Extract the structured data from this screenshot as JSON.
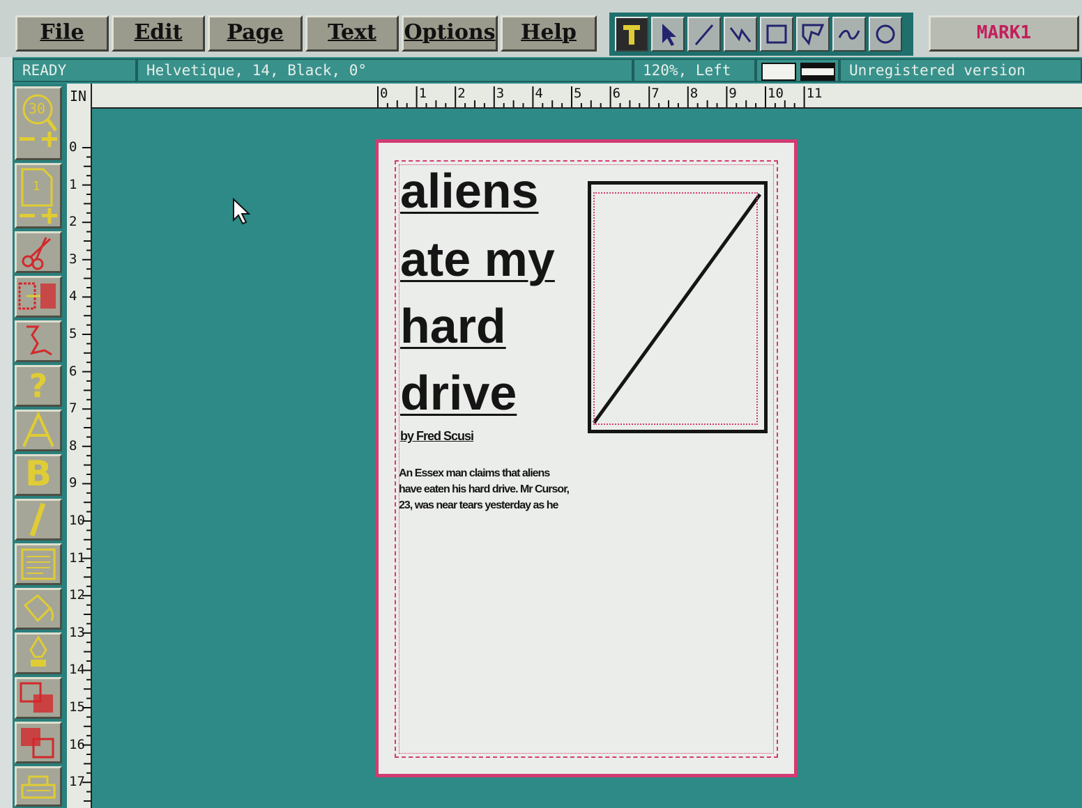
{
  "menu": {
    "items": [
      {
        "label": "File"
      },
      {
        "label": "Edit"
      },
      {
        "label": "Page"
      },
      {
        "label": "Text"
      },
      {
        "label": "Options"
      },
      {
        "label": "Help"
      }
    ]
  },
  "tools": [
    {
      "name": "text-tool",
      "active": true
    },
    {
      "name": "pointer-tool"
    },
    {
      "name": "line-tool"
    },
    {
      "name": "zigzag-line-tool"
    },
    {
      "name": "rectangle-tool"
    },
    {
      "name": "polygon-tool"
    },
    {
      "name": "freehand-tool"
    },
    {
      "name": "ellipse-tool"
    }
  ],
  "document_name": "MARK1",
  "status": {
    "state": "READY",
    "font_info": "Helvetique, 14, Black, 0°",
    "zoom_align": "120%, Left",
    "registration": "Unregistered version"
  },
  "toolbox": {
    "zoom_level": "30",
    "page_number": "1"
  },
  "ruler": {
    "unit": "IN",
    "horizontal_ticks": [
      "0",
      "1",
      "2",
      "3",
      "4",
      "5",
      "6",
      "7",
      "8",
      "9",
      "10",
      "11"
    ],
    "vertical_ticks": [
      "0",
      "1",
      "2",
      "3",
      "4",
      "5",
      "6",
      "7",
      "8",
      "9",
      "10",
      "11",
      "12",
      "13",
      "14",
      "15",
      "16",
      "17"
    ]
  },
  "article": {
    "headline_lines": [
      "aliens",
      "ate my",
      "hard",
      "drive"
    ],
    "byline": "by Fred Scusi",
    "body": "An Essex man claims that aliens have eaten his hard drive.  Mr Cursor, 23, was near tears yesterday as he"
  },
  "colors": {
    "desktop": "#2e8a86",
    "page_border": "#d23b73",
    "icon_yellow": "#e0cc35",
    "document_name": "#c21f5c"
  }
}
